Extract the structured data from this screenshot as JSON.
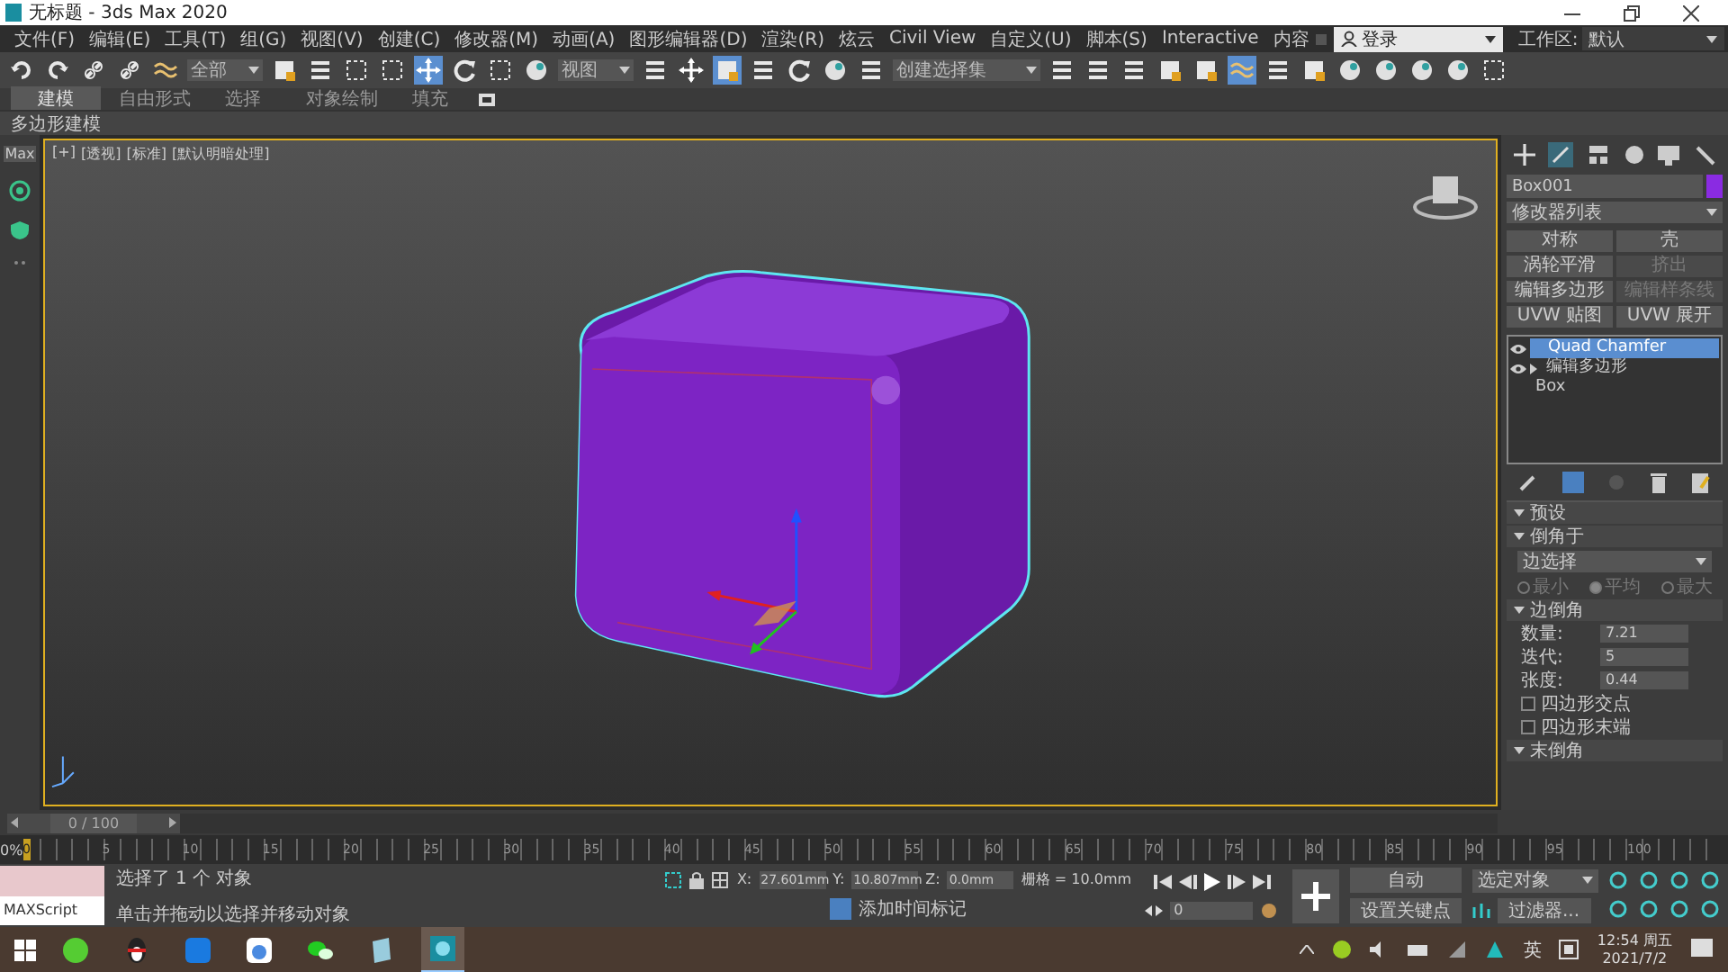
{
  "window": {
    "title": "无标题 - 3ds Max 2020"
  },
  "menu_bar": [
    "文件(F)",
    "编辑(E)",
    "工具(T)",
    "组(G)",
    "视图(V)",
    "创建(C)",
    "修改器(M)",
    "动画(A)",
    "图形编辑器(D)",
    "渲染(R)",
    "炫云",
    "Civil View",
    "自定义(U)",
    "脚本(S)",
    "Interactive",
    "内容"
  ],
  "login": {
    "label": "登录"
  },
  "workspace": {
    "label": "工作区:",
    "value": "默认"
  },
  "toolbar": {
    "selection_filter": "全部",
    "reference_coord": "视图",
    "named_selection": "创建选择集"
  },
  "ribbon_tabs": [
    {
      "label": "建模",
      "selected": true
    },
    {
      "label": "自由形式",
      "selected": false
    },
    {
      "label": "选择",
      "selected": false
    },
    {
      "label": "对象绘制",
      "selected": false
    },
    {
      "label": "填充",
      "selected": false
    }
  ],
  "ribbon_panel": {
    "label": "多边形建模"
  },
  "left_strip": {
    "label": "Max"
  },
  "viewport": {
    "labels": [
      "[+]",
      "[透视]",
      "[标准]",
      "[默认明暗处理]"
    ]
  },
  "command_panel": {
    "object_name": "Box001",
    "modifier_list": "修改器列表",
    "modifier_buttons": [
      {
        "label": "对称",
        "disabled": false
      },
      {
        "label": "壳",
        "disabled": false
      },
      {
        "label": "涡轮平滑",
        "disabled": false
      },
      {
        "label": "挤出",
        "disabled": true
      },
      {
        "label": "编辑多边形",
        "disabled": false
      },
      {
        "label": "编辑样条线",
        "disabled": true
      },
      {
        "label": "UVW 贴图",
        "disabled": false
      },
      {
        "label": "UVW 展开",
        "disabled": false
      }
    ],
    "stack": [
      {
        "label": "Quad Chamfer",
        "kind": "modifier",
        "selected": true
      },
      {
        "label": "编辑多边形",
        "kind": "expandable",
        "selected": false
      },
      {
        "label": "Box",
        "kind": "base",
        "selected": false
      }
    ],
    "presets": {
      "title": "预设"
    },
    "chamfer_by": {
      "title": "倒角于",
      "dropdown": "边选择",
      "disabled": true,
      "options": [
        {
          "label": "最小",
          "selected": false
        },
        {
          "label": "平均",
          "selected": true
        },
        {
          "label": "最大",
          "selected": false
        }
      ]
    },
    "edge_chamfer": {
      "title": "边倒角",
      "params": [
        {
          "label": "数量:",
          "value": "7.21"
        },
        {
          "label": "迭代:",
          "value": "5"
        },
        {
          "label": "张度:",
          "value": "0.44"
        }
      ],
      "checks": [
        {
          "label": "四边形交点",
          "checked": false
        },
        {
          "label": "四边形末端",
          "checked": false
        }
      ]
    },
    "end_chamfer": {
      "title": "末倒角"
    }
  },
  "timeline": {
    "frame": "0 / 100",
    "level": 0,
    "percent": "0%",
    "current_frame": "0",
    "ticks": [
      "5",
      "10",
      "15",
      "20",
      "25",
      "30",
      "35",
      "40",
      "45",
      "50",
      "55",
      "60",
      "65",
      "70",
      "75",
      "80",
      "85",
      "90",
      "95",
      "100"
    ]
  },
  "status": {
    "maxscript": "MAXScript",
    "selection": "选择了 1 个 对象",
    "prompt": "单击并拖动以选择并移动对象",
    "x_label": "X:",
    "x": "27.601mm",
    "y_label": "Y:",
    "y": "10.807mm",
    "z_label": "Z:",
    "z": "0.0mm",
    "grid": "栅格 = 10.0mm",
    "time_tag": "添加时间标记",
    "frame_field": "0",
    "auto_key": "自动",
    "key_filter": "选定对象",
    "set_key": "设置关键点",
    "filters": "过滤器..."
  },
  "taskbar": {
    "ime": "英",
    "time": "12:54 周五",
    "date": "2021/7/2"
  }
}
